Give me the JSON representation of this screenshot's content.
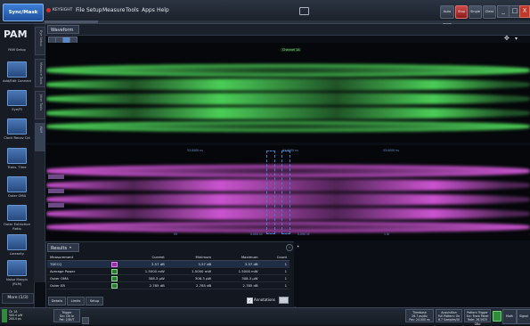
{
  "menubar": {
    "cycle_button": "Sync/Mask",
    "brand": "KEYSIGHT",
    "menus": [
      "File",
      "Setup",
      "Measure",
      "Tools",
      "Apps",
      "Help"
    ],
    "toolbar": [
      "Auto Scale",
      "Stop",
      "Single",
      "Clear"
    ],
    "window_buttons": [
      "_",
      "□",
      "X"
    ]
  },
  "sidebar": {
    "title": "PAM",
    "items": [
      {
        "label": "PAM Setup",
        "icon": "pam-setup-icon"
      },
      {
        "label": "Add/Edit Connect",
        "icon": "connect-icon"
      },
      {
        "label": "Eye/PJ",
        "icon": "eye-icon"
      },
      {
        "label": "Clock Recov Cal",
        "icon": "clock-recovery-icon"
      },
      {
        "label": "Trans. Time",
        "icon": "transition-time-icon"
      },
      {
        "label": "Outer OMA",
        "icon": "oma-icon"
      },
      {
        "label": "Outer Extinction Ratio",
        "icon": "extinction-ratio-icon"
      },
      {
        "label": "Linearity",
        "icon": "linearity-icon"
      },
      {
        "label": "Noise Margin (RLM)",
        "icon": "noise-margin-icon"
      }
    ],
    "more": "More (1/3)"
  },
  "vtabs": [
    "Eye Setup",
    "Measure Tools",
    "Jitter Tools",
    "PAM"
  ],
  "waveform": {
    "tab": "Waveform",
    "top_center_label": "Channel 1A",
    "bottom_markers": [
      "53.0000 ns",
      "53.0000 ns",
      "53.0000 ns"
    ],
    "bottom_axis": [
      "0V",
      "0.000 UI",
      "0.500 UI",
      "1 UI"
    ]
  },
  "results": {
    "tab": "Results",
    "columns": [
      "Measurement",
      "",
      "Current",
      "Minimum",
      "Maximum",
      "Count"
    ],
    "rows": [
      {
        "name": "TDECQ",
        "current": "3.57 dB",
        "min": "3.57 dB",
        "max": "3.57 dB",
        "count": "1",
        "color": "magenta"
      },
      {
        "name": "Average Power",
        "current": "1.5000 mW",
        "min": "1.5000 mW",
        "max": "1.5000 mW",
        "count": "1",
        "color": "green"
      },
      {
        "name": "Outer OMA",
        "current": "308.3 μW",
        "min": "308.3 μW",
        "max": "308.3 μW",
        "count": "1",
        "color": "green"
      },
      {
        "name": "Outer ER",
        "current": "2.785 dB",
        "min": "2.785 dB",
        "max": "2.785 dB",
        "count": "1",
        "color": "green"
      }
    ],
    "buttons": [
      "Details",
      "Limits",
      "Setup"
    ],
    "annotations_label": "Annotations"
  },
  "statusbar": {
    "channel": [
      "Ch 1A",
      "500.0 μW",
      "200.0 ps"
    ],
    "trigger": [
      "Trigger",
      "Src: Clk In",
      "Pat: 2/DUT"
    ],
    "boxes": [
      {
        "title": "Timebase",
        "lines": [
          "26.7 ps/div",
          "Pos: 24.000 ns"
        ]
      },
      {
        "title": "Acquisition",
        "lines": [
          "Full Pattern: On",
          "8.7 Samples/UI"
        ]
      },
      {
        "title": "Pattern Trigger",
        "lines": [
          "Src: Front Panel",
          "Rate: 26.5625 GBd"
        ]
      }
    ],
    "right_buttons": [
      "Math",
      "Signal"
    ]
  },
  "colors": {
    "top_eye": "#53e35f",
    "bottom_eye": "#e05ce6",
    "accent": "#3d7fd6"
  }
}
